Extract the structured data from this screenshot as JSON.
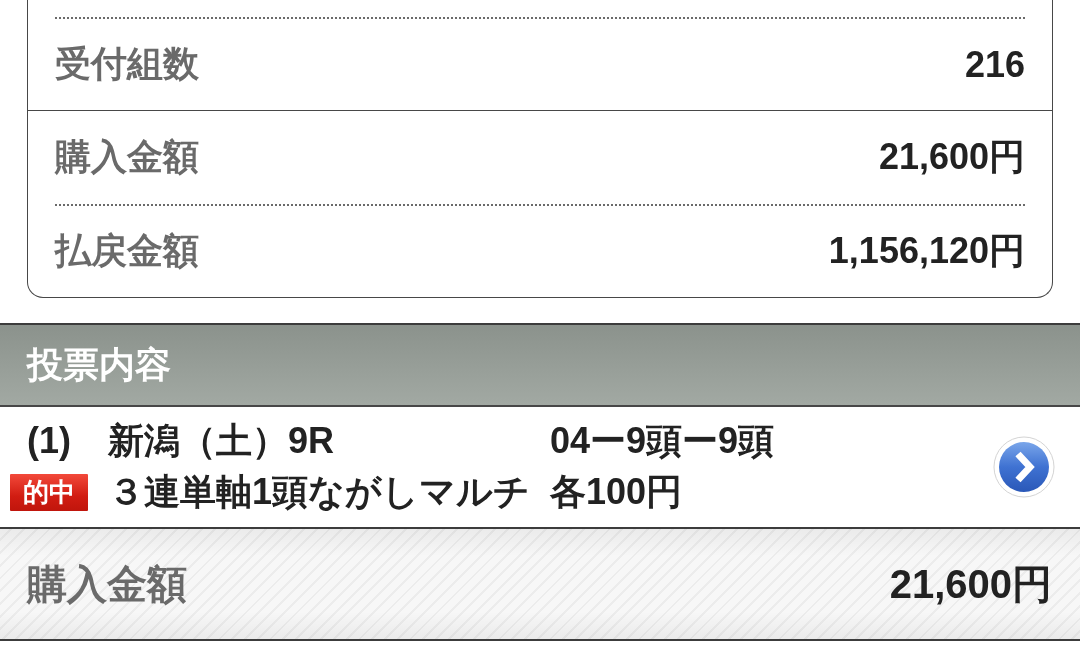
{
  "summary": {
    "groups": [
      {
        "rows": [
          {
            "label": "受付組数",
            "value": "216"
          }
        ]
      },
      {
        "rows": [
          {
            "label": "購入金額",
            "value": "21,600円"
          },
          {
            "label": "払戻金額",
            "value": "1,156,120円"
          }
        ]
      }
    ]
  },
  "section": {
    "title": "投票内容"
  },
  "tickets": [
    {
      "number": "(1)",
      "venue": "新潟（土）9R",
      "combination": "04ー9頭ー9頭",
      "badge": "的中",
      "bet_type": "３連単軸1頭ながしマルチ",
      "amount": "各100円"
    }
  ],
  "total": {
    "label": "購入金額",
    "value": "21,600円"
  }
}
